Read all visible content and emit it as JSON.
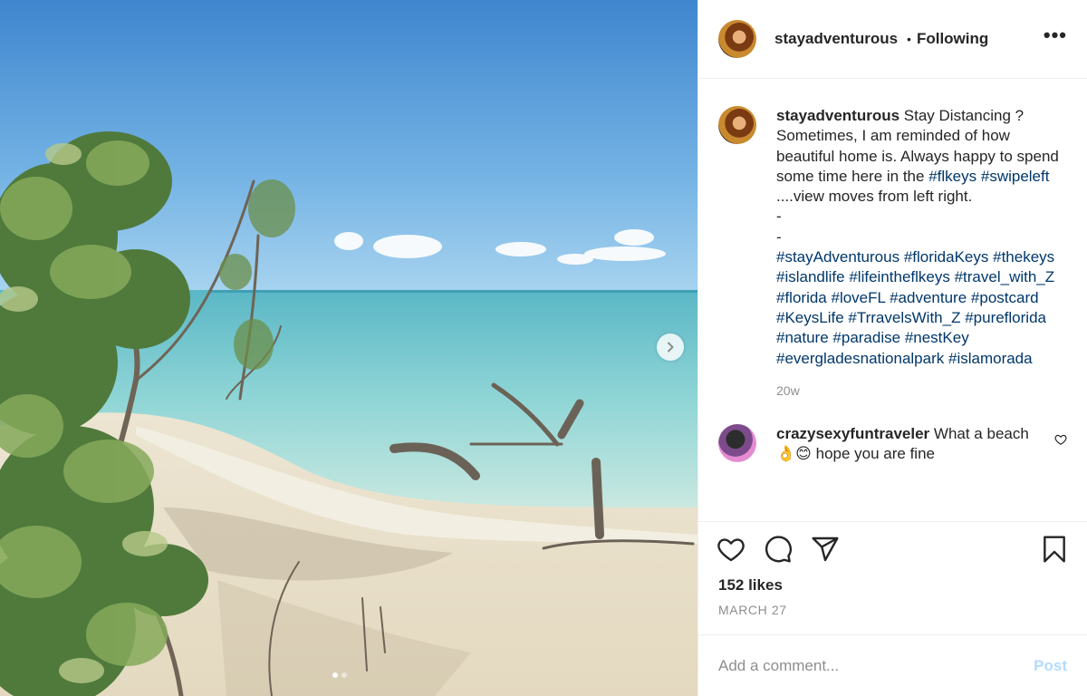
{
  "post": {
    "username": "stayadventurous",
    "separator": "•",
    "follow_status": "Following",
    "more_label": "•••"
  },
  "caption": {
    "username": "stayadventurous",
    "text_1": "Stay Distancing ? Sometimes, I am reminded of how beautiful home is. Always happy to spend some time here in the ",
    "tag_flkeys": "#flkeys",
    "tag_swipeleft": "#swipeleft",
    "text_2": " ....view moves from left right.",
    "dash_1": "-",
    "dash_2": "-",
    "hashtags": [
      "#stayAdventurous",
      "#floridaKeys",
      "#thekeys",
      "#islandlife",
      "#lifeintheflkeys",
      "#travel_with_Z",
      "#florida",
      "#loveFL",
      "#adventure",
      "#postcard",
      "#KeysLife",
      "#TrravelsWith_Z",
      "#pureflorida",
      "#nature",
      "#paradise",
      "#nestKey",
      "#evergladesnationalpark",
      "#islamorada"
    ],
    "time": "20w"
  },
  "comment": {
    "username": "crazysexyfuntraveler",
    "text": "What a beach 👌😊 hope you are fine"
  },
  "stats": {
    "likes": "152 likes",
    "date": "MARCH 27"
  },
  "add_comment": {
    "placeholder": "Add a comment...",
    "post_label": "Post"
  },
  "carousel": {
    "total_images": 2,
    "current_index": 1
  },
  "icons": [
    "more-icon",
    "like-icon",
    "comment-icon",
    "share-icon",
    "save-icon",
    "next-arrow-icon",
    "comment-like-icon"
  ]
}
